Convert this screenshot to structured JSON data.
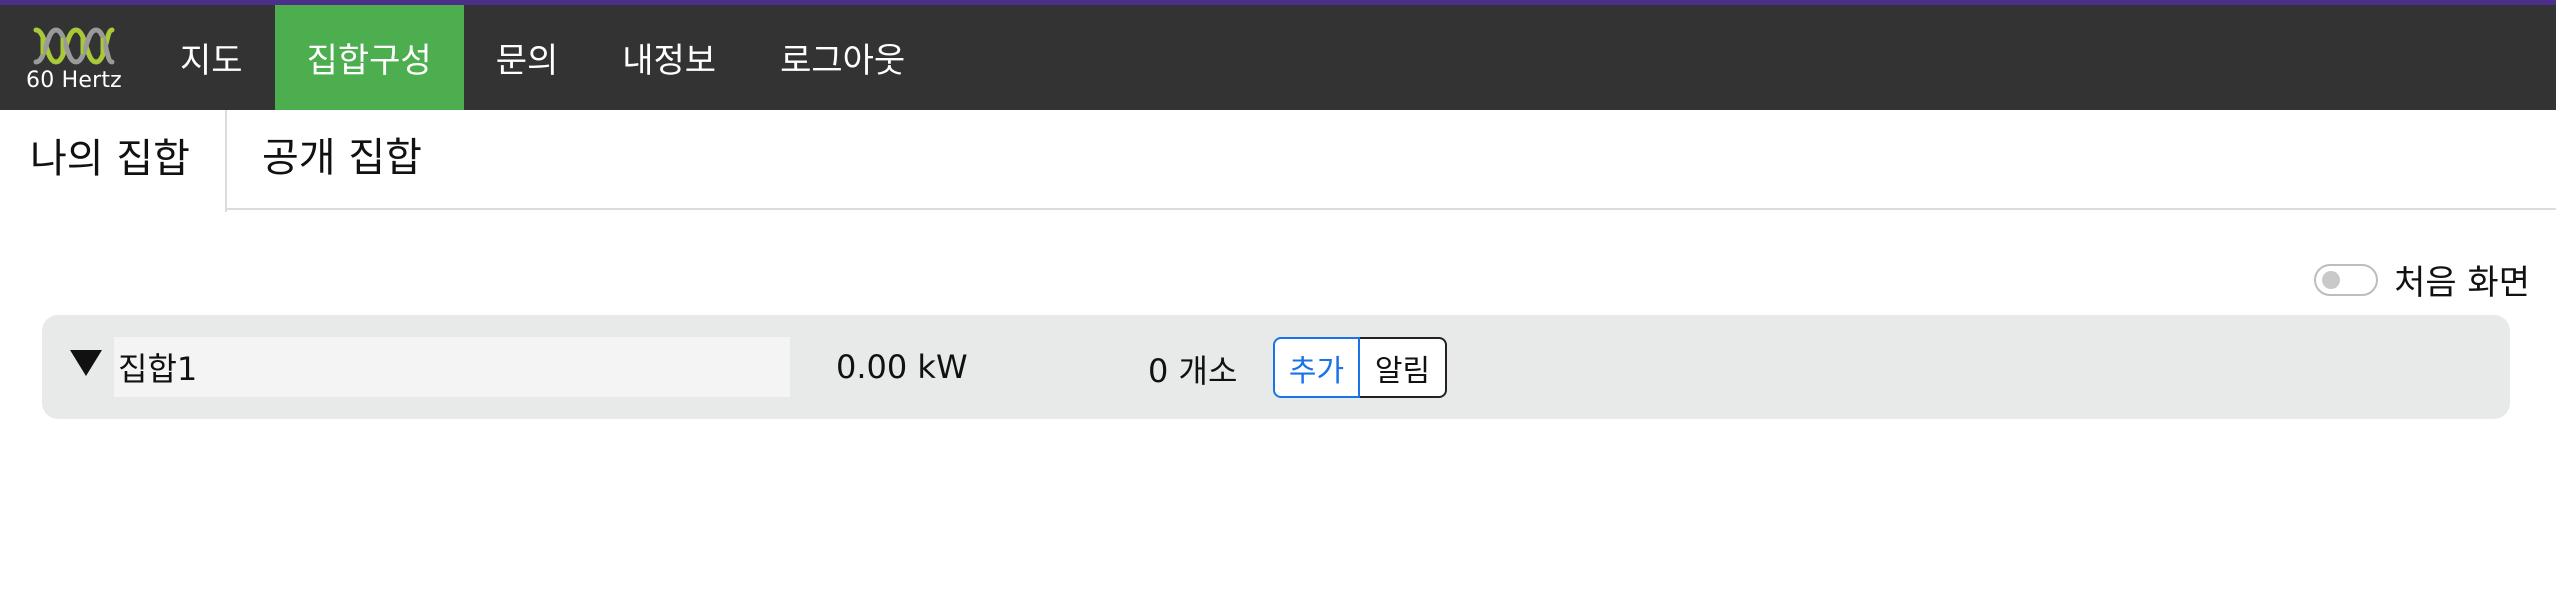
{
  "brand": {
    "logo_text": "60 Hertz",
    "logo_icon": "dna-helix-icon",
    "logo_colors": [
      "#a8c93a",
      "#8a8a8a"
    ]
  },
  "nav": {
    "items": [
      {
        "label": "지도",
        "active": false
      },
      {
        "label": "집합구성",
        "active": true
      },
      {
        "label": "문의",
        "active": false
      },
      {
        "label": "내정보",
        "active": false
      },
      {
        "label": "로그아웃",
        "active": false
      }
    ],
    "bar_color": "#333333",
    "active_color": "#4cae4f",
    "top_accent": "#4b2f8a"
  },
  "tabs": {
    "mine": "나의 집합",
    "public": "공개 집합",
    "selected": "mine"
  },
  "first_screen": {
    "label": "처음 화면",
    "enabled": false
  },
  "group": {
    "name": "집합1",
    "power": "0.00 kW",
    "count": "0 개소",
    "add_label": "추가",
    "alarm_label": "알림",
    "expanded": true
  }
}
